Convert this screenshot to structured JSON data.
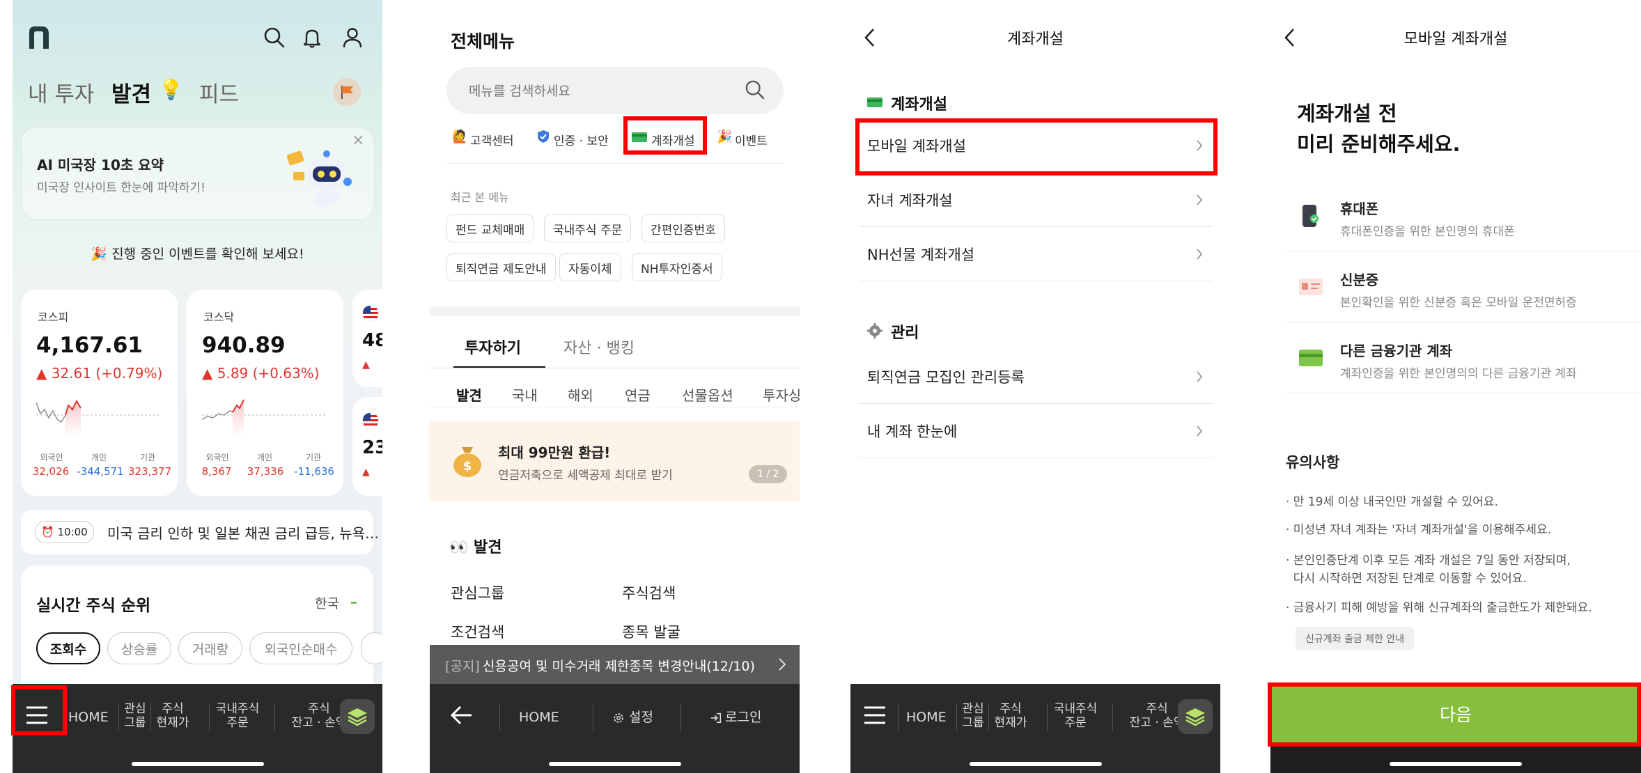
{
  "screen1": {
    "tabs": {
      "my_invest": "내 투자",
      "discover": "발견",
      "feed": "피드"
    },
    "banner": {
      "title": "AI 미국장 10초 요약",
      "subtitle": "미국장 인사이트 한눈에 파악하기!",
      "close": "×"
    },
    "event_text": "🎉 진행 중인 이벤트를 확인해 보세요!",
    "kospi": {
      "name": "코스피",
      "value": "4,167.61",
      "change": "▲ 32.61 (+0.79%)",
      "labels": [
        "외국인",
        "개인",
        "기관"
      ],
      "nums": [
        "32,026",
        "-344,571",
        "323,377"
      ]
    },
    "kosdaq": {
      "name": "코스닥",
      "value": "940.89",
      "change": "▲ 5.89 (+0.63%)",
      "labels": [
        "외국인",
        "개인",
        "기관"
      ],
      "nums": [
        "8,367",
        "37,336",
        "-11,636"
      ]
    },
    "partial_card_top": "48",
    "partial_card_bottom": "23",
    "news": {
      "time": "⏰ 10:00",
      "text": "미국 금리 인하 및 일본 채권 금리 급등, 뉴욕…"
    },
    "ranking": {
      "title": "실시간 주식 순위",
      "region": "한국",
      "pills": [
        "조회수",
        "상승률",
        "거래량",
        "외국인순매수"
      ]
    },
    "bottom": {
      "home": "HOME",
      "items": [
        "관심\n그룹",
        "주식\n현재가",
        "국내주식\n주문",
        "주식\n잔고 · 손익"
      ]
    }
  },
  "screen2": {
    "title": "전체메뉴",
    "search_placeholder": "메뉴를 검색하세요",
    "quick": [
      "고객센터",
      "인증 · 보안",
      "계좌개설",
      "이벤트"
    ],
    "recent_label": "최근 본 메뉴",
    "recent_chips": [
      "펀드 교체매매",
      "국내주식 주문",
      "간편인증번호",
      "퇴직연금 제도안내",
      "자동이체",
      "NH투자인증서"
    ],
    "main_tabs": [
      "투자하기",
      "자산 · 뱅킹"
    ],
    "sub_tabs": [
      "발견",
      "국내",
      "해외",
      "연금",
      "선물옵션",
      "투자싱"
    ],
    "promo": {
      "title": "최대 99만원 환급!",
      "subtitle": "연금저축으로 세액공제 최대로 받기",
      "pager": "1 / 2"
    },
    "section": "👀 발견",
    "menu_items": [
      "관심그룹",
      "주식검색",
      "조건검색",
      "종목 발굴"
    ],
    "notice": {
      "tag": "[공지]",
      "text": "신용공여 및 미수거래 제한종목 변경안내(12/10)"
    },
    "bottom": {
      "home": "HOME",
      "settings": "설정",
      "login": "로그인"
    }
  },
  "screen3": {
    "title": "계좌개설",
    "section1": "계좌개설",
    "items1": [
      "모바일 계좌개설",
      "자녀 계좌개설",
      "NH선물 계좌개설"
    ],
    "section2": "관리",
    "items2": [
      "퇴직연금 모집인 관리등록",
      "내 계좌 한눈에"
    ],
    "bottom": {
      "home": "HOME",
      "items": [
        "관심\n그룹",
        "주식\n현재가",
        "국내주식\n주문",
        "주식\n잔고 · 손익"
      ]
    }
  },
  "screen4": {
    "title": "모바일 계좌개설",
    "heading_line1": "계좌개설 전",
    "heading_line2": "미리 준비해주세요.",
    "items": [
      {
        "title": "휴대폰",
        "desc": "휴대폰인증을 위한 본인명의 휴대폰"
      },
      {
        "title": "신분증",
        "desc": "본인확인을 위한 신분증 혹은 모바일 운전면허증"
      },
      {
        "title": "다른 금융기관 계좌",
        "desc": "계좌인증을 위한 본인명의의 다른 금융기관 계좌"
      }
    ],
    "notes_title": "유의사항",
    "notes": [
      "· 만 19세 이상 내국인만 개설할 수 있어요.",
      "· 미성년 자녀 계좌는 '자녀 계좌개설'을 이용해주세요.",
      "· 본인인증단계 이후 모든 계좌 개설은 7일 동안 저장되며,",
      "  다시 시작하면 저장된 단계로 이동할 수 있어요.",
      "· 금융사기 피해 예방을 위해 신규계좌의 출금한도가 제한돼요."
    ],
    "limit_chip": "신규계좌 출금 제한 안내",
    "next_button": "다음"
  },
  "colors": {
    "accent_green": "#86bf3d",
    "highlight_red": "#ff0000",
    "up_red": "#e0352f",
    "down_blue": "#2f6fd6",
    "bar_dark": "#2a2a2a"
  }
}
